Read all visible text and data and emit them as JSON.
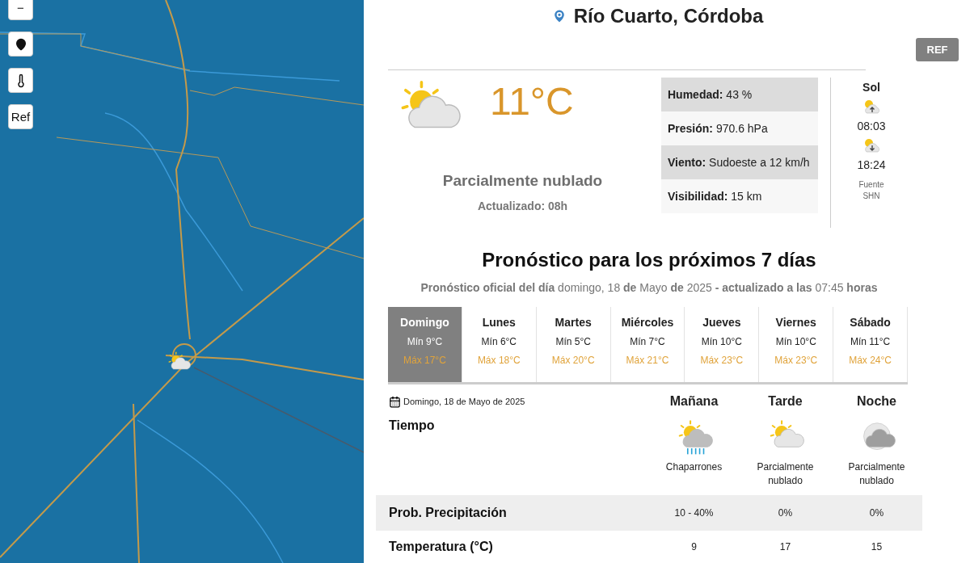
{
  "map": {
    "kind": "picture",
    "controls": [
      {
        "kind": "text",
        "label": "−"
      },
      {
        "kind": "pin"
      },
      {
        "kind": "thermometer"
      },
      {
        "kind": "text",
        "label": "Ref"
      }
    ],
    "marker": {
      "kind": "partly_cloudy"
    }
  },
  "location": {
    "title": "Río Cuarto, Córdoba"
  },
  "ref_button": "REF",
  "current": {
    "kind": "partly_cloudy",
    "temperature": "11°C",
    "condition": "Parcialmente nublado",
    "updated": "Actualizado: 08h",
    "details": [
      {
        "label": "Humedad:",
        "value": "43 %"
      },
      {
        "label": "Presión:",
        "value": "970.6 hPa"
      },
      {
        "label": "Viento:",
        "value": "Sudoeste a 12 km/h"
      },
      {
        "label": "Visibilidad:",
        "value": "15 km"
      }
    ],
    "sun": {
      "title": "Sol",
      "sunrise": "08:03",
      "sunset": "18:24",
      "source_label": "Fuente",
      "source_name": "SHN"
    }
  },
  "forecast": {
    "title": "Pronóstico para los próximos 7 días",
    "subtitle": "**Pronóstico oficial del día** domingo, 18 **de** Mayo **de** 2025 **- actualizado a las** 07:45 **horas**",
    "days": [
      {
        "name": "Domingo",
        "min": "Mín 9°C",
        "max": "Máx 17°C",
        "selected": true
      },
      {
        "name": "Lunes",
        "min": "Mín 6°C",
        "max": "Máx 18°C",
        "selected": false
      },
      {
        "name": "Martes",
        "min": "Mín 5°C",
        "max": "Máx 20°C",
        "selected": false
      },
      {
        "name": "Miércoles",
        "min": "Mín 7°C",
        "max": "Máx 21°C",
        "selected": false
      },
      {
        "name": "Jueves",
        "min": "Mín 10°C",
        "max": "Máx 23°C",
        "selected": false
      },
      {
        "name": "Viernes",
        "min": "Mín 10°C",
        "max": "Máx 23°C",
        "selected": false
      },
      {
        "name": "Sábado",
        "min": "Mín 11°C",
        "max": "Máx 24°C",
        "selected": false
      }
    ],
    "detail": {
      "date": "Domingo, 18 de Mayo de 2025",
      "row_labels": {
        "weather": "Tiempo",
        "precipitation": "Prob. Precipitación",
        "temperature": "Temperatura (°C)"
      },
      "periods": [
        {
          "name": "Mañana",
          "kind": "showers",
          "condition": "Chaparrones",
          "precipitation": "10 - 40%",
          "temperature": "9"
        },
        {
          "name": "Tarde",
          "kind": "partly_cloudy",
          "condition": "Parcialmente nublado",
          "precipitation": "0%",
          "temperature": "17"
        },
        {
          "name": "Noche",
          "kind": "night_cloudy",
          "condition": "Parcialmente nublado",
          "precipitation": "0%",
          "temperature": "15"
        }
      ]
    }
  }
}
